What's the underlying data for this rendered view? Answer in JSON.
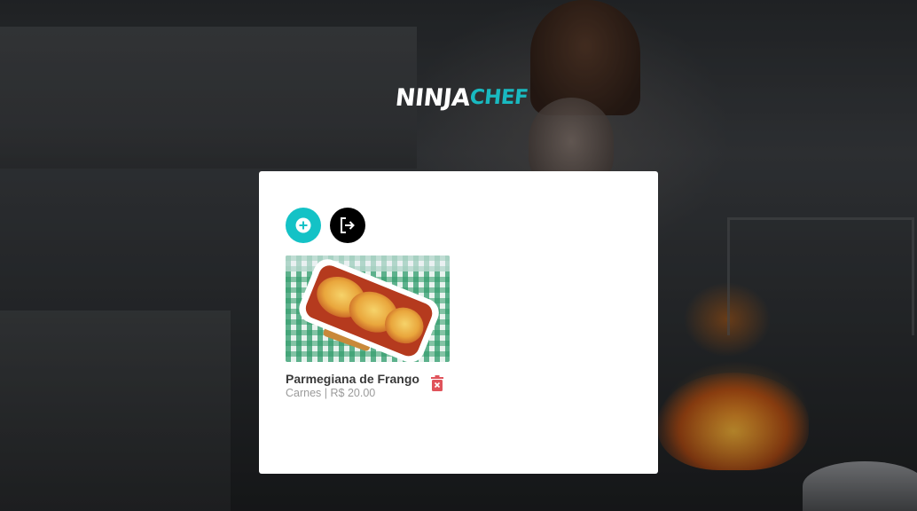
{
  "brand": {
    "logo_part1": "NINJA",
    "logo_part2": "CHEF",
    "accent_color": "#19b9c0"
  },
  "toolbar": {
    "add_icon": "plus-circle-icon",
    "logout_icon": "sign-out-icon",
    "add_color": "#14c2c6",
    "logout_color": "#000000"
  },
  "recipes": [
    {
      "name": "Parmegiana de Frango",
      "category_price": "Carnes | R$ 20.00",
      "photo": "chicken-parmigiana-photo",
      "delete_icon": "trash-icon",
      "delete_color": "#e0535b"
    }
  ]
}
